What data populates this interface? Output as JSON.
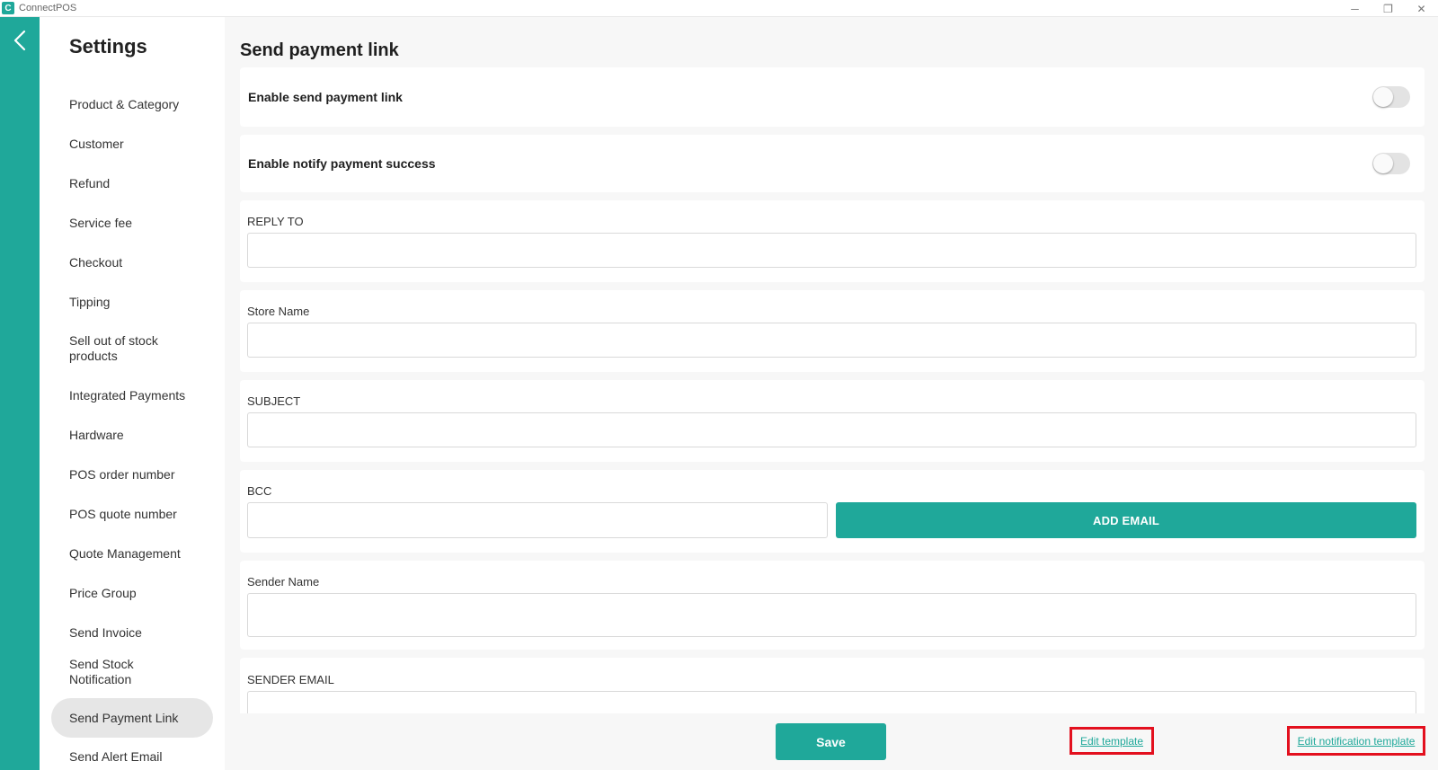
{
  "window": {
    "title": "ConnectPOS",
    "logo_text": "C",
    "controls": {
      "minimize": "─",
      "restore": "❐",
      "close": "✕"
    }
  },
  "sidebar": {
    "title": "Settings",
    "items": [
      {
        "label": "Product & Category"
      },
      {
        "label": "Customer"
      },
      {
        "label": "Refund"
      },
      {
        "label": "Service fee"
      },
      {
        "label": "Checkout"
      },
      {
        "label": "Tipping"
      },
      {
        "label": "Sell out of stock products"
      },
      {
        "label": "Integrated Payments"
      },
      {
        "label": "Hardware"
      },
      {
        "label": "POS order number"
      },
      {
        "label": "POS quote number"
      },
      {
        "label": "Quote Management"
      },
      {
        "label": "Price Group"
      },
      {
        "label": "Send Invoice"
      },
      {
        "label": "Send Stock Notification"
      },
      {
        "label": "Send Payment Link",
        "active": true
      },
      {
        "label": "Send Alert Email"
      }
    ]
  },
  "main": {
    "title": "Send payment link",
    "toggles": [
      {
        "label": "Enable send payment link",
        "on": false
      },
      {
        "label": "Enable notify payment success",
        "on": false
      }
    ],
    "fields": {
      "reply_to": {
        "label": "REPLY TO",
        "value": "",
        "placeholder": ""
      },
      "store_name": {
        "label": "Store Name",
        "value": "",
        "placeholder": ""
      },
      "subject": {
        "label": "SUBJECT",
        "value": "",
        "placeholder": ""
      },
      "bcc": {
        "label": "BCC",
        "value": "",
        "placeholder": "",
        "add_button": "ADD EMAIL"
      },
      "sender_name": {
        "label": "Sender Name",
        "value": "",
        "placeholder": ""
      },
      "sender_email": {
        "label": "SENDER EMAIL",
        "value": "",
        "placeholder": ""
      }
    }
  },
  "footer": {
    "save_label": "Save",
    "edit_template_label": "Edit template",
    "edit_notification_template_label": "Edit notification template"
  },
  "colors": {
    "accent": "#1fa89a",
    "highlight_box": "#e3101e",
    "active_item_bg": "#e6e6e6"
  }
}
